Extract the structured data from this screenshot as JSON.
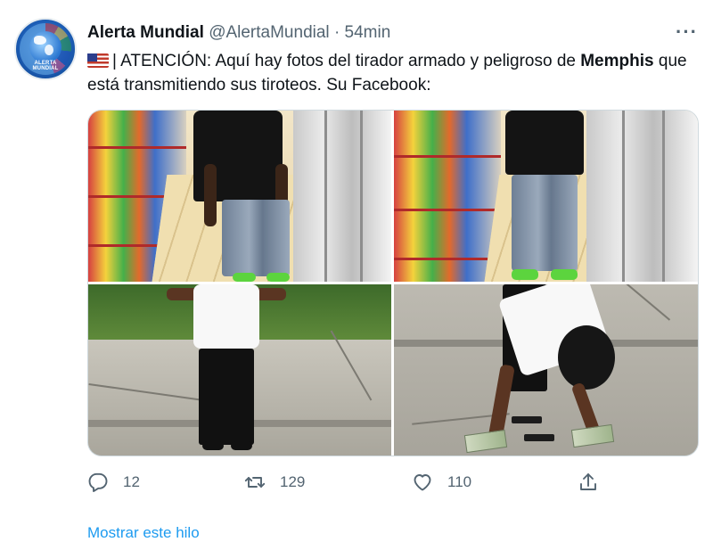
{
  "tweet": {
    "author_name": "Alerta Mundial",
    "author_handle": "@AlertaMundial",
    "separator": "·",
    "time": "54min",
    "more_label": "···",
    "avatar_text": "ALERTA MUNDIAL",
    "text_part1": "| ATENCIÓN: Aquí hay fotos del tirador armado y peligroso de ",
    "text_bold": "Memphis",
    "text_part2": " que está transmitiendo sus tiroteos. Su Facebook:",
    "flag_icon": "us-flag-icon"
  },
  "actions": {
    "reply_count": "12",
    "retweet_count": "129",
    "like_count": "110"
  },
  "footer": {
    "show_more": "Mostrar este hilo"
  },
  "colors": {
    "text": "#0f1419",
    "secondary": "#536471",
    "link": "#1d9bf0",
    "border": "#cfd9de"
  }
}
